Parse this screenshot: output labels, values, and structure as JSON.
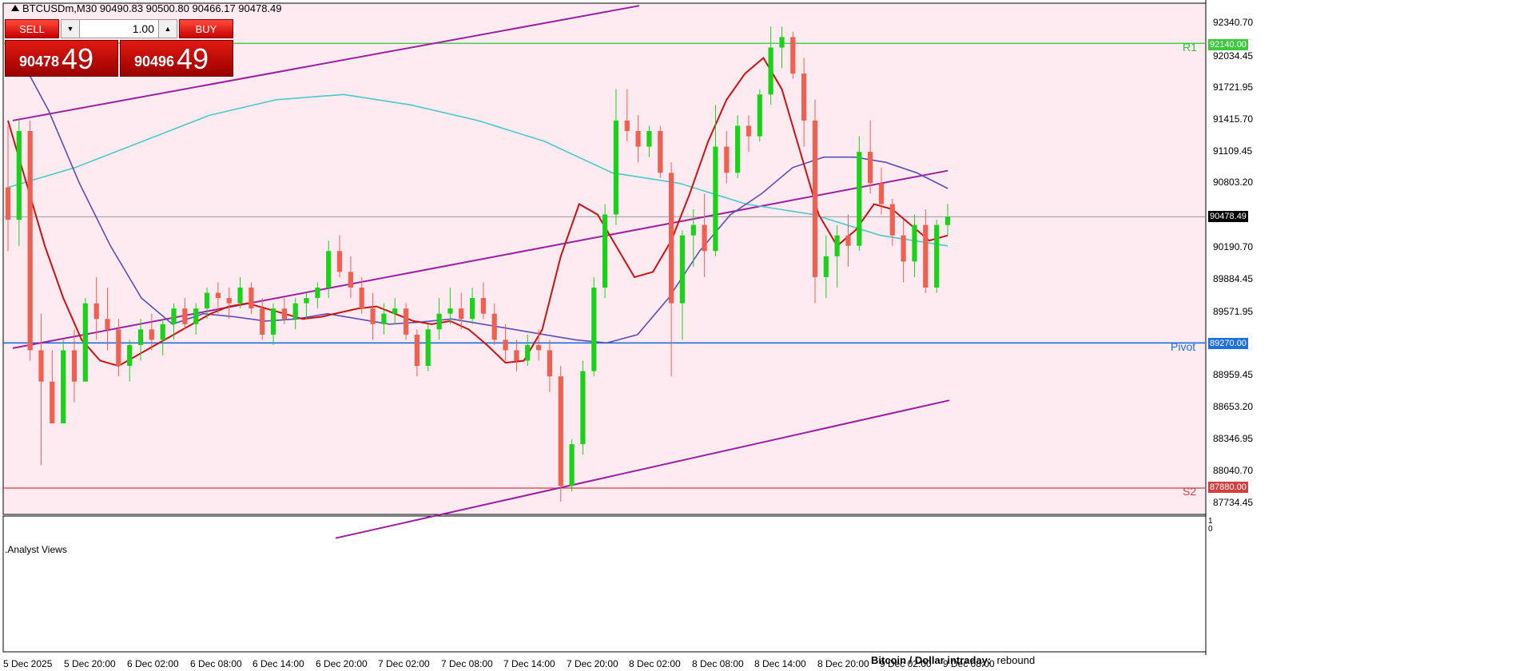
{
  "symbol_info": "BTCUSDm,M30  90490.83 90500.80 90466.17 90478.49",
  "trade_panel": {
    "sell_label": "SELL",
    "buy_label": "BUY",
    "lots": "1.00",
    "sell_price_small": "90478",
    "sell_price_big": "49",
    "buy_price_small": "90496",
    "buy_price_big": "49"
  },
  "y_ticks": [
    "92340.70",
    "92034.45",
    "91721.95",
    "91415.70",
    "91109.45",
    "90803.20",
    "90190.70",
    "89884.45",
    "89571.95",
    "88959.45",
    "88653.20",
    "88346.95",
    "88040.70",
    "87734.45"
  ],
  "x_ticks": [
    "5 Dec 2025",
    "5 Dec 20:00",
    "6 Dec 02:00",
    "6 Dec 08:00",
    "6 Dec 14:00",
    "6 Dec 20:00",
    "7 Dec 02:00",
    "7 Dec 08:00",
    "7 Dec 14:00",
    "7 Dec 20:00",
    "8 Dec 02:00",
    "8 Dec 08:00",
    "8 Dec 14:00",
    "8 Dec 20:00",
    "9 Dec 02:00",
    "9 Dec 08:00"
  ],
  "price_tags": {
    "r1": "92140.00",
    "current": "90478.49",
    "pivot": "89270.00",
    "s2": "87880.00"
  },
  "level_labels": {
    "r1": "R1",
    "pivot": "Pivot",
    "s2": "S2"
  },
  "subwindow": {
    "title": ".Analyst Views",
    "scale_top": "1",
    "scale_bottom": "0",
    "headline_bold": "Bitcoin / Dollar intraday:",
    "headline_text": "rebound"
  },
  "colors": {
    "background": "#fdebf1",
    "bull_candle": "#19d219",
    "bear_candle": "#f06050",
    "r1_line": "#2ec82e",
    "pivot_line": "#1e6fd9",
    "s2_line": "#d04040",
    "channel": "#9b1fa0",
    "ma_fast": "#cc1111",
    "ma_mid": "#5a4db8",
    "ma_slow": "#4cc9c9"
  },
  "chart_data": {
    "type": "candlestick",
    "title": "BTCUSDm,M30",
    "xlabel": "",
    "ylabel": "",
    "ylim": [
      87630,
      92440
    ],
    "grid": false,
    "levels": [
      {
        "name": "R1",
        "value": 92140.0
      },
      {
        "name": "Pivot",
        "value": 89270.0
      },
      {
        "name": "S2",
        "value": 87880.0
      }
    ],
    "candles_ohlc": [
      [
        90760,
        91350,
        90150,
        90450
      ],
      [
        90450,
        91400,
        90200,
        91300
      ],
      [
        91300,
        91400,
        89100,
        89200
      ],
      [
        89200,
        89550,
        88100,
        88900
      ],
      [
        88900,
        89200,
        88600,
        88500
      ],
      [
        88500,
        89300,
        88500,
        89200
      ],
      [
        89200,
        89400,
        88700,
        88900
      ],
      [
        88900,
        89700,
        88900,
        89650
      ],
      [
        89650,
        89900,
        89300,
        89500
      ],
      [
        89500,
        89800,
        89200,
        89400
      ],
      [
        89400,
        89500,
        88950,
        89050
      ],
      [
        89050,
        89300,
        88900,
        89250
      ],
      [
        89250,
        89500,
        89100,
        89400
      ],
      [
        89400,
        89550,
        89200,
        89300
      ],
      [
        89300,
        89500,
        89150,
        89450
      ],
      [
        89450,
        89650,
        89300,
        89600
      ],
      [
        89600,
        89700,
        89400,
        89450
      ],
      [
        89450,
        89650,
        89350,
        89600
      ],
      [
        89600,
        89800,
        89500,
        89750
      ],
      [
        89750,
        89850,
        89550,
        89700
      ],
      [
        89700,
        89800,
        89500,
        89650
      ],
      [
        89650,
        89900,
        89600,
        89800
      ],
      [
        89800,
        89850,
        89550,
        89600
      ],
      [
        89600,
        89700,
        89300,
        89350
      ],
      [
        89350,
        89650,
        89250,
        89600
      ],
      [
        89600,
        89700,
        89450,
        89500
      ],
      [
        89500,
        89700,
        89400,
        89650
      ],
      [
        89650,
        89750,
        89500,
        89700
      ],
      [
        89700,
        89850,
        89600,
        89800
      ],
      [
        89800,
        90250,
        89700,
        90150
      ],
      [
        90150,
        90300,
        89900,
        89950
      ],
      [
        89950,
        90100,
        89700,
        89800
      ],
      [
        89800,
        89900,
        89550,
        89600
      ],
      [
        89600,
        89750,
        89300,
        89450
      ],
      [
        89450,
        89650,
        89350,
        89550
      ],
      [
        89550,
        89700,
        89450,
        89600
      ],
      [
        89600,
        89650,
        89300,
        89350
      ],
      [
        89350,
        89400,
        88950,
        89050
      ],
      [
        89050,
        89450,
        89000,
        89400
      ],
      [
        89400,
        89700,
        89300,
        89550
      ],
      [
        89550,
        89800,
        89450,
        89600
      ],
      [
        89600,
        89750,
        89400,
        89500
      ],
      [
        89500,
        89800,
        89450,
        89700
      ],
      [
        89700,
        89850,
        89500,
        89550
      ],
      [
        89550,
        89650,
        89250,
        89300
      ],
      [
        89300,
        89450,
        89100,
        89200
      ],
      [
        89200,
        89300,
        89000,
        89100
      ],
      [
        89100,
        89350,
        89050,
        89250
      ],
      [
        89250,
        89400,
        89100,
        89200
      ],
      [
        89200,
        89300,
        88800,
        88950
      ],
      [
        88950,
        89050,
        87750,
        87900
      ],
      [
        87900,
        88350,
        87850,
        88300
      ],
      [
        88300,
        89100,
        88200,
        89000
      ],
      [
        89000,
        89900,
        88950,
        89800
      ],
      [
        89800,
        90600,
        89700,
        90500
      ],
      [
        90500,
        91700,
        90400,
        91400
      ],
      [
        91400,
        91700,
        91200,
        91300
      ],
      [
        91300,
        91450,
        91000,
        91150
      ],
      [
        91150,
        91350,
        91050,
        91300
      ],
      [
        91300,
        91350,
        90850,
        90900
      ],
      [
        90900,
        91000,
        88950,
        89650
      ],
      [
        89650,
        90350,
        89300,
        90300
      ],
      [
        90300,
        90550,
        90000,
        90400
      ],
      [
        90400,
        90700,
        89900,
        90150
      ],
      [
        90150,
        91550,
        90100,
        91150
      ],
      [
        91150,
        91300,
        90800,
        90900
      ],
      [
        90900,
        91450,
        90850,
        91350
      ],
      [
        91350,
        91450,
        91100,
        91250
      ],
      [
        91250,
        91700,
        91200,
        91650
      ],
      [
        91650,
        92300,
        91550,
        92100
      ],
      [
        92100,
        92300,
        91900,
        92200
      ],
      [
        92200,
        92250,
        91800,
        91850
      ],
      [
        91850,
        92000,
        91150,
        91400
      ],
      [
        91400,
        91600,
        89650,
        89900
      ],
      [
        89900,
        90300,
        89700,
        90100
      ],
      [
        90100,
        90400,
        89800,
        90300
      ],
      [
        90300,
        90500,
        90000,
        90200
      ],
      [
        90200,
        91250,
        90150,
        91100
      ],
      [
        91100,
        91400,
        90700,
        90800
      ],
      [
        90800,
        90950,
        90500,
        90600
      ],
      [
        90600,
        90650,
        90200,
        90300
      ],
      [
        90300,
        90450,
        89850,
        90050
      ],
      [
        90050,
        90500,
        89900,
        90400
      ],
      [
        90400,
        90550,
        89750,
        89800
      ],
      [
        89800,
        90450,
        89750,
        90400
      ],
      [
        90400,
        90600,
        90300,
        90478.49
      ]
    ],
    "ma_fast": [
      91400,
      90800,
      90200,
      89700,
      89300,
      89100,
      89050,
      89150,
      89250,
      89350,
      89450,
      89550,
      89620,
      89650,
      89600,
      89550,
      89500,
      89520,
      89560,
      89600,
      89620,
      89550,
      89480,
      89450,
      89480,
      89400,
      89250,
      89080,
      89100,
      89400,
      90100,
      90600,
      90500,
      90200,
      89900,
      89950,
      90250,
      90700,
      91200,
      91600,
      91850,
      92000,
      91700,
      91100,
      90500,
      90200,
      90350,
      90600,
      90550,
      90400,
      90250,
      90300
    ],
    "ma_mid": [
      92050,
      91500,
      90800,
      90200,
      89700,
      89450,
      89550,
      89520,
      89480,
      89500,
      89550,
      89500,
      89450,
      89470,
      89500,
      89450,
      89400,
      89350,
      89300,
      89270,
      89350,
      89700,
      90150,
      90500,
      90700,
      90950,
      91050,
      91050,
      91000,
      90900,
      90750
    ],
    "ma_slow": [
      90760,
      90950,
      91200,
      91450,
      91600,
      91650,
      91550,
      91400,
      91200,
      90900,
      90800,
      90600,
      90500,
      90300,
      90200
    ],
    "channel_top": [
      [
        0,
        91400
      ],
      [
        85,
        92500
      ]
    ],
    "channel_mid": [
      [
        0,
        89220
      ],
      [
        100,
        90920
      ]
    ],
    "channel_bottom": [
      [
        0,
        87400
      ],
      [
        100,
        88720
      ]
    ]
  }
}
